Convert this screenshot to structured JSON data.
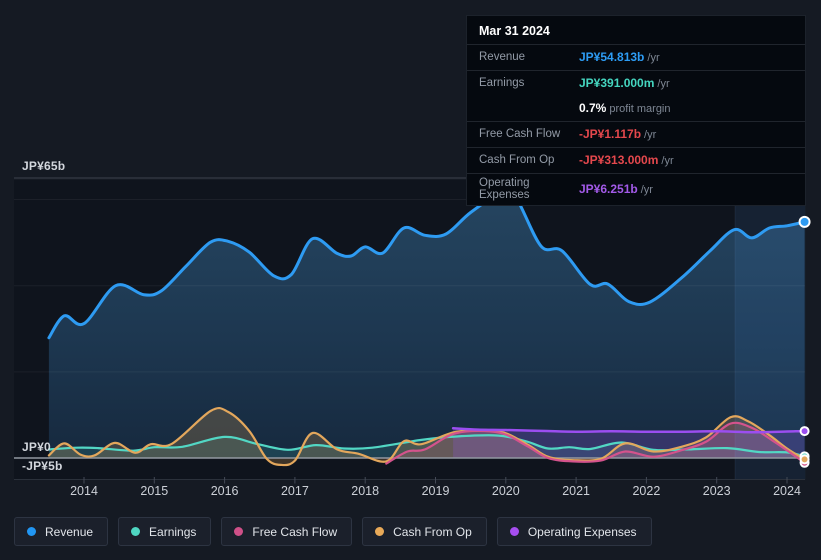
{
  "tooltip": {
    "date": "Mar 31 2024",
    "rows": [
      {
        "label": "Revenue",
        "value": "JP¥54.813b",
        "suffix": "/yr",
        "color": "#2d9cf4",
        "separator": true
      },
      {
        "label": "Earnings",
        "value": "JP¥391.000m",
        "suffix": "/yr",
        "color": "#45d6c0",
        "separator": true
      },
      {
        "label": "",
        "value": "0.7%",
        "suffix": "profit margin",
        "color": "#ffffff",
        "separator": false
      },
      {
        "label": "Free Cash Flow",
        "value": "-JP¥1.117b",
        "suffix": "/yr",
        "color": "#e5484d",
        "separator": true
      },
      {
        "label": "Cash From Op",
        "value": "-JP¥313.000m",
        "suffix": "/yr",
        "color": "#e5484d",
        "separator": true
      },
      {
        "label": "Operating Expenses",
        "value": "JP¥6.251b",
        "suffix": "/yr",
        "color": "#a35ae9",
        "separator": true
      }
    ]
  },
  "legend": {
    "items": [
      {
        "label": "Revenue",
        "color": "#2196f3"
      },
      {
        "label": "Earnings",
        "color": "#4fd6c2"
      },
      {
        "label": "Free Cash Flow",
        "color": "#cf5088"
      },
      {
        "label": "Cash From Op",
        "color": "#e8a958"
      },
      {
        "label": "Operating Expenses",
        "color": "#a64ef0"
      }
    ]
  },
  "chart_data": {
    "type": "area",
    "unit": "JP¥ billions per year",
    "x_axis": {
      "tick_labels": [
        "2014",
        "2015",
        "2016",
        "2017",
        "2018",
        "2019",
        "2020",
        "2021",
        "2022",
        "2023",
        "2024"
      ],
      "tick_values": [
        2014,
        2015,
        2016,
        2017,
        2018,
        2019,
        2020,
        2021,
        2022,
        2023,
        2024
      ],
      "range": [
        2013.0,
        2024.26
      ]
    },
    "y_axis": {
      "labels": [
        "JP¥65b",
        "JP¥0",
        "-JP¥5b"
      ],
      "label_values": [
        65,
        0,
        -5
      ],
      "unlabeled_gridlines": [
        20,
        40,
        60
      ],
      "range": [
        -5,
        65
      ]
    },
    "highlight_band": {
      "from": 2023.26,
      "to": 2024.26
    },
    "series": [
      {
        "name": "Revenue",
        "color": "#2e9bf2",
        "width": 3,
        "fill": "revenue-gradient",
        "end_dot": true,
        "dot_r": 5,
        "points": [
          [
            2013.5,
            27.9
          ],
          [
            2013.72,
            33.0
          ],
          [
            2014.0,
            31.2
          ],
          [
            2014.45,
            40.0
          ],
          [
            2014.85,
            37.9
          ],
          [
            2015.1,
            38.8
          ],
          [
            2015.45,
            44.5
          ],
          [
            2015.8,
            50.1
          ],
          [
            2016.05,
            50.3
          ],
          [
            2016.35,
            47.8
          ],
          [
            2016.7,
            42.3
          ],
          [
            2016.95,
            42.6
          ],
          [
            2017.25,
            50.9
          ],
          [
            2017.6,
            47.5
          ],
          [
            2017.8,
            46.9
          ],
          [
            2018.0,
            49.0
          ],
          [
            2018.25,
            47.6
          ],
          [
            2018.55,
            53.4
          ],
          [
            2018.85,
            51.7
          ],
          [
            2019.15,
            52.0
          ],
          [
            2019.5,
            57.0
          ],
          [
            2019.95,
            61.7
          ],
          [
            2020.15,
            60.3
          ],
          [
            2020.5,
            49.2
          ],
          [
            2020.8,
            48.1
          ],
          [
            2021.2,
            40.3
          ],
          [
            2021.45,
            40.4
          ],
          [
            2021.75,
            36.3
          ],
          [
            2022.05,
            36.2
          ],
          [
            2022.5,
            41.8
          ],
          [
            2022.9,
            48.0
          ],
          [
            2023.25,
            53.0
          ],
          [
            2023.5,
            51.1
          ],
          [
            2023.75,
            53.4
          ],
          [
            2024.0,
            53.9
          ],
          [
            2024.25,
            54.813
          ]
        ]
      },
      {
        "name": "Earnings",
        "color": "#52d7c4",
        "width": 2.2,
        "fill": "rgba(82,215,196,0.14)",
        "end_dot": true,
        "dot_r": 4,
        "points": [
          [
            2013.5,
            2.0
          ],
          [
            2013.9,
            2.4
          ],
          [
            2014.2,
            2.3
          ],
          [
            2014.7,
            1.7
          ],
          [
            2015.0,
            2.5
          ],
          [
            2015.4,
            2.6
          ],
          [
            2016.0,
            4.9
          ],
          [
            2016.45,
            3.3
          ],
          [
            2016.9,
            1.9
          ],
          [
            2017.3,
            3.0
          ],
          [
            2017.7,
            2.2
          ],
          [
            2018.1,
            2.4
          ],
          [
            2018.8,
            4.2
          ],
          [
            2019.3,
            5.0
          ],
          [
            2019.9,
            5.2
          ],
          [
            2020.3,
            3.8
          ],
          [
            2020.6,
            2.2
          ],
          [
            2020.9,
            2.5
          ],
          [
            2021.2,
            2.1
          ],
          [
            2021.65,
            3.6
          ],
          [
            2022.1,
            1.9
          ],
          [
            2022.6,
            2.0
          ],
          [
            2023.15,
            2.3
          ],
          [
            2023.6,
            1.4
          ],
          [
            2024.0,
            1.3
          ],
          [
            2024.25,
            0.391
          ]
        ]
      },
      {
        "name": "Free Cash Flow",
        "color": "#d4538c",
        "width": 2.2,
        "fill": "rgba(212,83,140,0.20)",
        "end_dot": true,
        "dot_r": 4,
        "points": [
          [
            2018.3,
            -1.3
          ],
          [
            2018.6,
            1.5
          ],
          [
            2018.85,
            2.0
          ],
          [
            2019.3,
            5.8
          ],
          [
            2019.9,
            5.9
          ],
          [
            2020.3,
            2.8
          ],
          [
            2020.6,
            0.0
          ],
          [
            2020.95,
            -0.8
          ],
          [
            2021.35,
            -0.6
          ],
          [
            2021.7,
            1.5
          ],
          [
            2022.1,
            0.3
          ],
          [
            2022.5,
            1.8
          ],
          [
            2022.85,
            3.8
          ],
          [
            2023.2,
            8.0
          ],
          [
            2023.5,
            7.0
          ],
          [
            2023.8,
            4.0
          ],
          [
            2024.05,
            1.2
          ],
          [
            2024.25,
            -1.117
          ]
        ]
      },
      {
        "name": "Cash From Op",
        "color": "#e3a75c",
        "width": 2.2,
        "fill": "rgba(226,166,83,0.22)",
        "end_dot": true,
        "dot_r": 4,
        "points": [
          [
            2013.5,
            0.6
          ],
          [
            2013.72,
            3.4
          ],
          [
            2013.95,
            0.8
          ],
          [
            2014.15,
            0.6
          ],
          [
            2014.44,
            3.5
          ],
          [
            2014.73,
            1.2
          ],
          [
            2014.95,
            3.2
          ],
          [
            2015.25,
            3.3
          ],
          [
            2015.8,
            10.9
          ],
          [
            2016.05,
            10.7
          ],
          [
            2016.35,
            6.3
          ],
          [
            2016.6,
            -0.2
          ],
          [
            2016.8,
            -1.6
          ],
          [
            2017.0,
            -0.6
          ],
          [
            2017.25,
            5.8
          ],
          [
            2017.6,
            2.0
          ],
          [
            2017.9,
            1.0
          ],
          [
            2018.3,
            -0.8
          ],
          [
            2018.55,
            3.9
          ],
          [
            2018.8,
            3.2
          ],
          [
            2019.3,
            6.1
          ],
          [
            2019.9,
            6.2
          ],
          [
            2020.3,
            3.2
          ],
          [
            2020.6,
            0.3
          ],
          [
            2020.95,
            -0.5
          ],
          [
            2021.35,
            -0.2
          ],
          [
            2021.7,
            3.4
          ],
          [
            2022.1,
            1.5
          ],
          [
            2022.5,
            2.6
          ],
          [
            2022.85,
            4.8
          ],
          [
            2023.2,
            9.5
          ],
          [
            2023.45,
            8.5
          ],
          [
            2023.75,
            5.3
          ],
          [
            2024.0,
            2.2
          ],
          [
            2024.25,
            -0.313
          ]
        ]
      },
      {
        "name": "Operating Expenses",
        "color": "#9b4ef0",
        "width": 2.5,
        "fill": "rgba(140,85,220,0.26)",
        "end_dot": true,
        "dot_r": 4,
        "points": [
          [
            2019.25,
            6.9
          ],
          [
            2019.6,
            6.6
          ],
          [
            2020.0,
            6.5
          ],
          [
            2020.5,
            6.3
          ],
          [
            2021.0,
            6.1
          ],
          [
            2021.5,
            6.2
          ],
          [
            2022.0,
            6.1
          ],
          [
            2022.5,
            6.1
          ],
          [
            2023.0,
            6.2
          ],
          [
            2023.5,
            6.0
          ],
          [
            2024.0,
            6.15
          ],
          [
            2024.25,
            6.251
          ]
        ]
      }
    ]
  }
}
